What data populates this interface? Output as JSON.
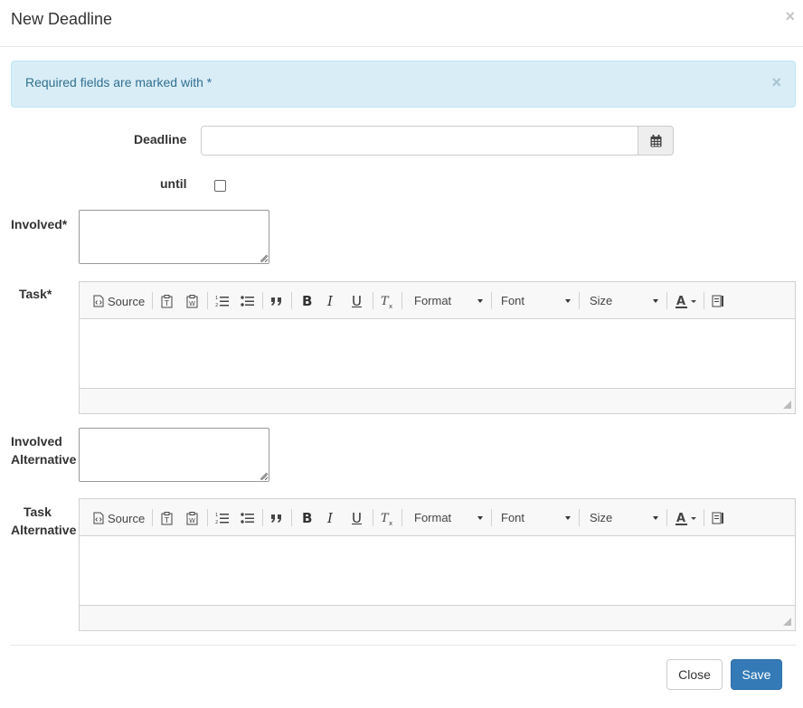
{
  "header": {
    "title": "New Deadline",
    "close_glyph": "×"
  },
  "alert": {
    "text": "Required fields are marked with *",
    "close_glyph": "×"
  },
  "fields": {
    "deadline_label": "Deadline",
    "deadline_value": "",
    "until_label": "until",
    "until_checked": false,
    "involved_label": "Involved*",
    "involved_value": "",
    "task_label": "Task*",
    "involved_alt_label_line1": "Involved",
    "involved_alt_label_line2": "Alternative",
    "involved_alt_value": "",
    "task_alt_label_line1": "Task",
    "task_alt_label_line2": "Alternative"
  },
  "toolbar": {
    "source_label": "Source",
    "format_label": "Format",
    "font_label": "Font",
    "size_label": "Size",
    "icons": [
      "source-icon",
      "paste-text-icon",
      "paste-word-icon",
      "numbered-list-icon",
      "bulleted-list-icon",
      "blockquote-icon",
      "bold-icon",
      "italic-icon",
      "underline-icon",
      "remove-format-icon",
      "text-color-icon",
      "maximize-icon"
    ],
    "bold_glyph": "B",
    "italic_glyph": "I",
    "underline_glyph": "U"
  },
  "footer": {
    "close_label": "Close",
    "save_label": "Save"
  },
  "colors": {
    "primary": "#337ab7",
    "alert_bg": "#d9edf7",
    "alert_text": "#31708f"
  }
}
